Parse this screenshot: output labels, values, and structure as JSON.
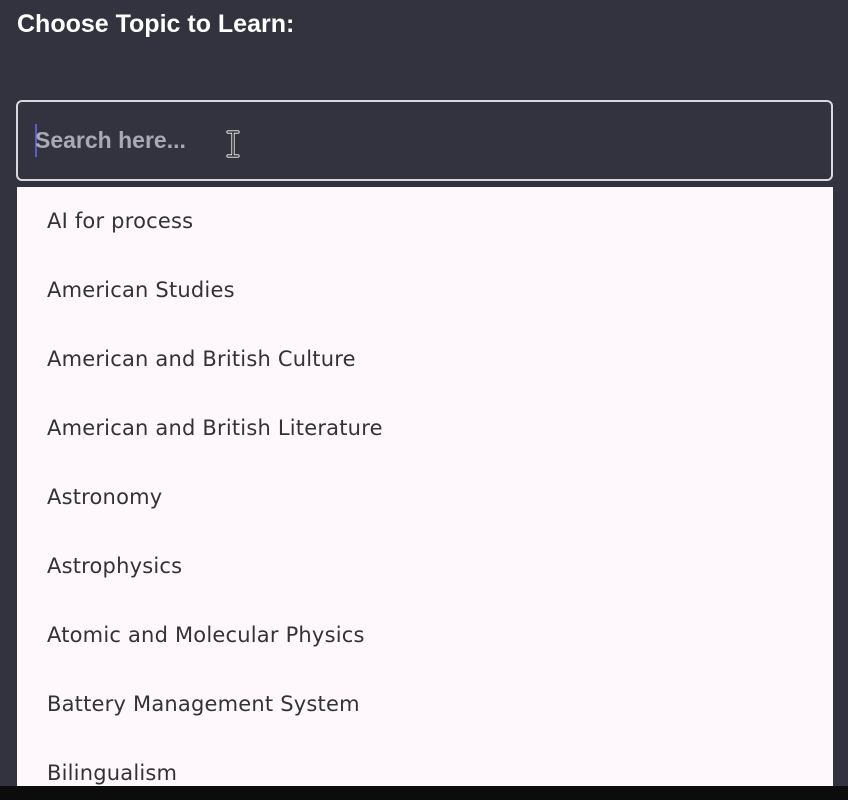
{
  "page": {
    "title": "Choose Topic to Learn:"
  },
  "search": {
    "placeholder": "Search here...",
    "value": ""
  },
  "topics": [
    {
      "label": "AI for process"
    },
    {
      "label": "American Studies"
    },
    {
      "label": "American and British Culture"
    },
    {
      "label": "American and British Literature"
    },
    {
      "label": "Astronomy"
    },
    {
      "label": "Astrophysics"
    },
    {
      "label": "Atomic and Molecular Physics"
    },
    {
      "label": "Battery Management System"
    },
    {
      "label": "Bilingualism"
    }
  ],
  "colors": {
    "background": "#33333f",
    "dropdown": "#fef8fc",
    "text_caret": "#5b5cc8"
  },
  "icons": {
    "cursor": "text-cursor-icon"
  }
}
